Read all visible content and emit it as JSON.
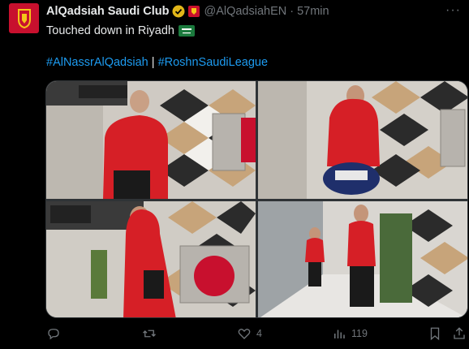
{
  "author": {
    "name": "AlQadsiah Saudi Club",
    "handle": "@AlQadsiahEN",
    "separator": "·",
    "time": "57min",
    "brand_color": "#c8102e"
  },
  "tweet": {
    "text": "Touched down in Riyadh",
    "emoji": "saudi-flag-icon",
    "hashtag_1": "#AlNassrAlQadsiah",
    "hashtag_sep": " | ",
    "hashtag_2": "#RoshnSaudiLeague",
    "link_color": "#1d9bf0"
  },
  "media": [
    {
      "name": "photo-player-red-jacket-backpack"
    },
    {
      "name": "photo-player-hood-duffel-bag"
    },
    {
      "name": "photo-player-cap-crossbody-bag"
    },
    {
      "name": "photo-players-walking-corridor"
    }
  ],
  "actions": {
    "reply": {
      "icon": "reply-icon",
      "count": ""
    },
    "retweet": {
      "icon": "retweet-icon",
      "count": ""
    },
    "like": {
      "icon": "heart-icon",
      "count": "4"
    },
    "views": {
      "icon": "views-icon",
      "count": "119"
    },
    "bookmark": {
      "icon": "bookmark-icon"
    },
    "share": {
      "icon": "share-icon"
    }
  },
  "colors": {
    "text": "#e7e9ea",
    "muted": "#71767b",
    "background": "#000000"
  }
}
